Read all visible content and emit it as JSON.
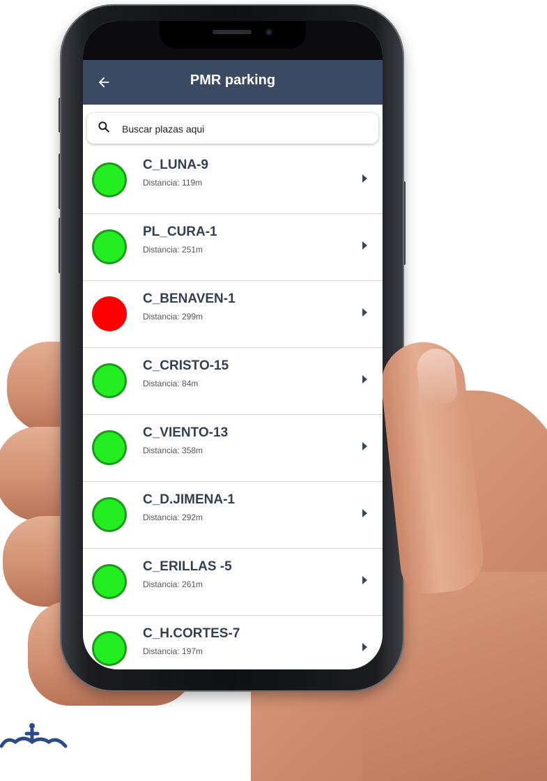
{
  "app_bar": {
    "title": "PMR parking",
    "back_icon": "arrow-left-icon",
    "color": "#3a4a63"
  },
  "search": {
    "placeholder": "Buscar plazas aqui",
    "icon": "search-icon"
  },
  "colors": {
    "available": "#22ee22",
    "occupied": "#ff0000",
    "title_text": "#33404f"
  },
  "distance_label": "Distancia:",
  "spots": [
    {
      "name": "C_LUNA-9",
      "distance": "119m",
      "status": "available"
    },
    {
      "name": "PL_CURA-1",
      "distance": "251m",
      "status": "available"
    },
    {
      "name": "C_BENAVEN-1",
      "distance": "299m",
      "status": "occupied"
    },
    {
      "name": "C_CRISTO-15",
      "distance": "84m",
      "status": "available"
    },
    {
      "name": "C_VIENTO-13",
      "distance": "358m",
      "status": "available"
    },
    {
      "name": "C_D.JIMENA-1",
      "distance": "292m",
      "status": "available"
    },
    {
      "name": "C_ERILLAS -5",
      "distance": "261m",
      "status": "available"
    },
    {
      "name": "C_H.CORTES-7",
      "distance": "197m",
      "status": "available"
    }
  ]
}
